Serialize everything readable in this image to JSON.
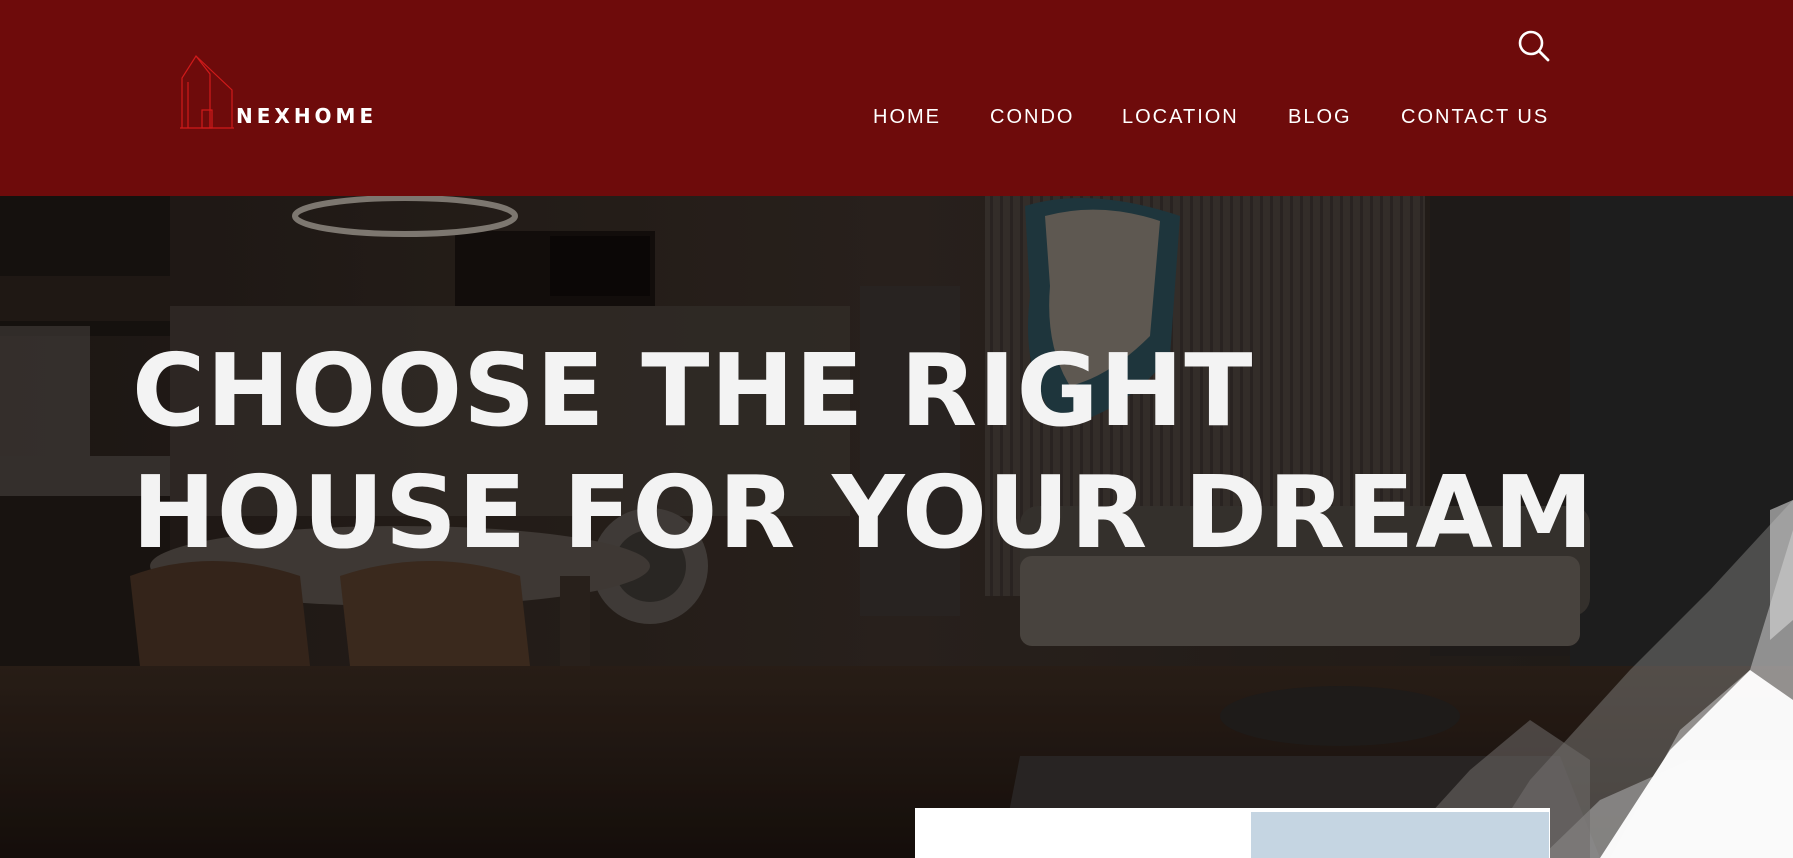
{
  "brand": {
    "name": "NEXHOME",
    "logo_icon": "house-outline-icon",
    "primary_color": "#6e0b0b",
    "logo_color": "#d11a1a"
  },
  "header": {
    "search_icon": "search-icon",
    "nav": [
      {
        "label": "HOME"
      },
      {
        "label": "CONDO"
      },
      {
        "label": "LOCATION"
      },
      {
        "label": "BLOG"
      },
      {
        "label": "CONTACT US"
      }
    ]
  },
  "hero": {
    "headline_line1": "CHOOSE THE RIGHT",
    "headline_line2": "HOUSE FOR YOUR DREAM",
    "background": "dark modern condo interior with kitchen, dining table and sofa"
  },
  "colors": {
    "header_bg": "#6e0b0b",
    "headline_text": "#f3f3f3",
    "card_bg": "#ffffff",
    "card_image_bg": "#c5d5e2"
  }
}
